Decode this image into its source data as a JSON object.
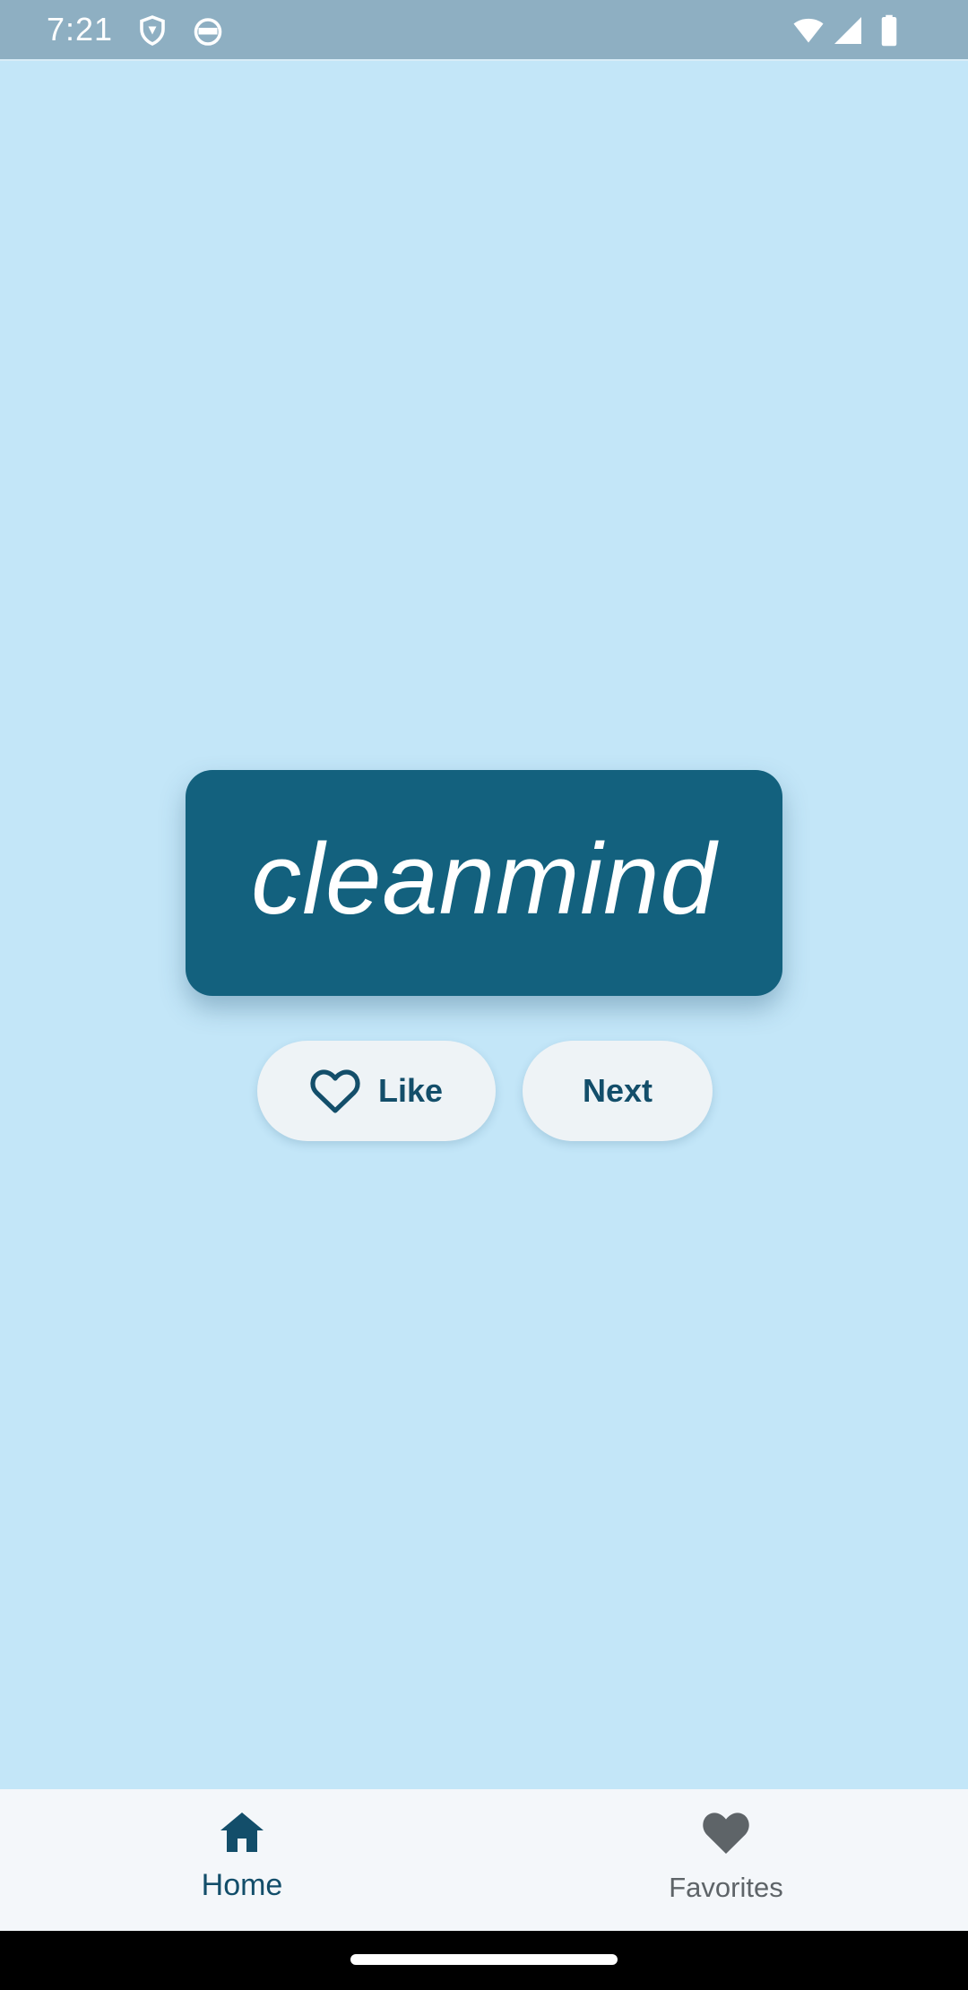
{
  "status_bar": {
    "time": "7:21",
    "icons": [
      "shield-icon",
      "android-icon",
      "wifi-icon",
      "signal-icon",
      "battery-icon"
    ]
  },
  "main": {
    "word": "cleanmind",
    "like_button": {
      "label": "Like",
      "icon": "heart-outline-icon"
    },
    "next_button": {
      "label": "Next"
    }
  },
  "bottom_nav": {
    "items": [
      {
        "label": "Home",
        "icon": "home-icon",
        "selected": true
      },
      {
        "label": "Favorites",
        "icon": "heart-icon",
        "selected": false
      }
    ]
  },
  "colors": {
    "background": "#c3e6f8",
    "card": "#13617e",
    "primary_text": "#134e6a",
    "button_bg": "#eef3f6",
    "nav_bg": "#f4f7fa",
    "inactive": "#5e6468"
  }
}
